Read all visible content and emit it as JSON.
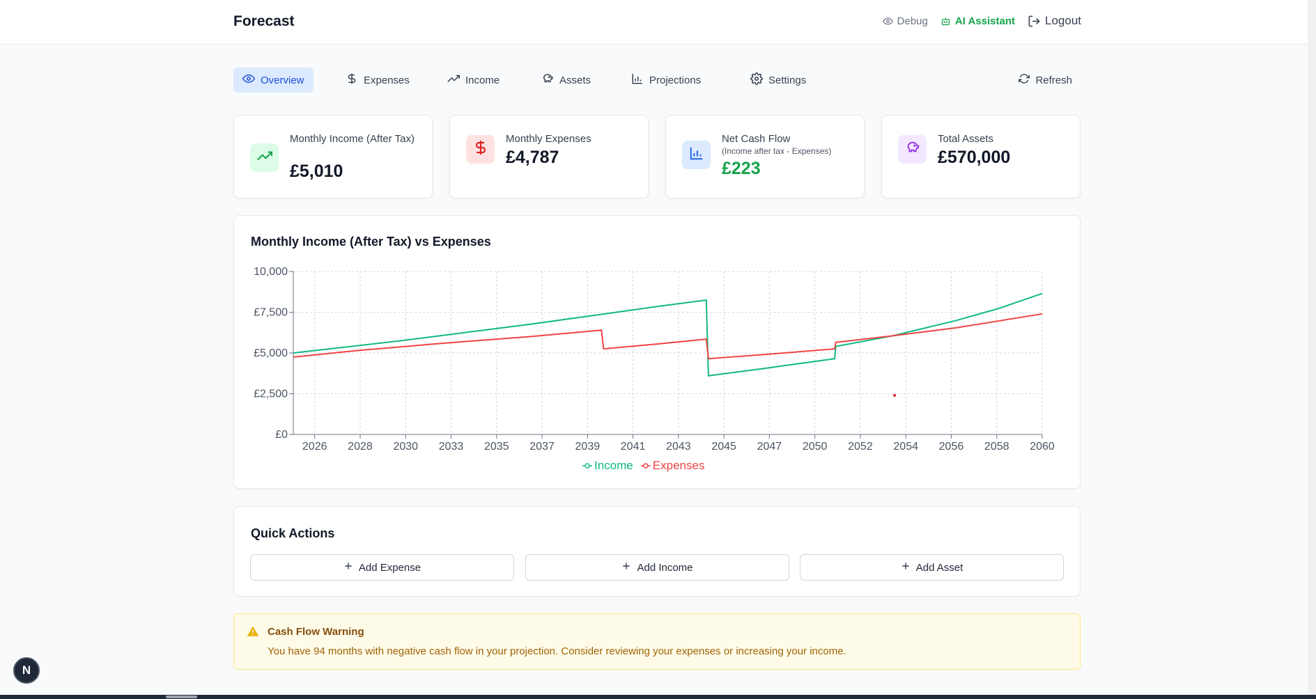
{
  "app": {
    "title": "Forecast"
  },
  "topnav": {
    "debug": "Debug",
    "ai_assistant": "AI Assistant",
    "logout": "Logout"
  },
  "tabs": [
    {
      "label": "Overview",
      "icon": "eye-icon",
      "active": true
    },
    {
      "label": "Expenses",
      "icon": "dollar-icon"
    },
    {
      "label": "Income",
      "icon": "trending-up-icon"
    },
    {
      "label": "Assets",
      "icon": "piggy-bank-icon"
    },
    {
      "label": "Projections",
      "icon": "bar-chart-icon"
    },
    {
      "label": "Settings",
      "icon": "gear-icon"
    }
  ],
  "refresh_label": "Refresh",
  "stats": [
    {
      "label": "Monthly Income (After Tax)",
      "value": "£5,010",
      "icon": "trending-up-icon",
      "color": "#16a34a"
    },
    {
      "label": "Monthly Expenses",
      "value": "£4,787",
      "icon": "dollar-icon",
      "color": "#dc2626"
    },
    {
      "label": "Net Cash Flow",
      "sublabel": "(Income after tax - Expenses)",
      "value": "£223",
      "icon": "bar-chart-icon",
      "color": "#2563eb"
    },
    {
      "label": "Total Assets",
      "value": "£570,000",
      "icon": "piggy-bank-icon",
      "color": "#9333ea"
    }
  ],
  "chart_data": {
    "type": "line",
    "title": "Monthly Income (After Tax) vs Expenses",
    "xlabel": "",
    "ylabel": "",
    "x_ticks": [
      "2026",
      "2028",
      "2030",
      "2033",
      "2035",
      "2037",
      "2039",
      "2041",
      "2043",
      "2045",
      "2047",
      "2050",
      "2052",
      "2054",
      "2056",
      "2058",
      "2060"
    ],
    "y_ticks": [
      "£0",
      "£2,500",
      "£5,000",
      "£7,500",
      "10,000"
    ],
    "ylim": [
      0,
      10000
    ],
    "xlim": [
      2025,
      2060
    ],
    "grid": true,
    "legend": "bottom-center",
    "series": [
      {
        "name": "Income",
        "color": "#10b981",
        "points": [
          [
            2025.0,
            5000
          ],
          [
            2027.0,
            5300
          ],
          [
            2030.0,
            5750
          ],
          [
            2033.0,
            6250
          ],
          [
            2036.0,
            6750
          ],
          [
            2039.0,
            7300
          ],
          [
            2042.0,
            7850
          ],
          [
            2044.3,
            8250
          ],
          [
            2044.4,
            3600
          ],
          [
            2047.0,
            4050
          ],
          [
            2050.3,
            4650
          ],
          [
            2050.35,
            5400
          ],
          [
            2053.0,
            6050
          ],
          [
            2056.0,
            7000
          ],
          [
            2058.0,
            7750
          ],
          [
            2060.0,
            8650
          ]
        ]
      },
      {
        "name": "Expenses",
        "color": "#ef4444",
        "points": [
          [
            2025.0,
            4750
          ],
          [
            2028.0,
            5150
          ],
          [
            2032.0,
            5600
          ],
          [
            2036.0,
            6000
          ],
          [
            2039.4,
            6400
          ],
          [
            2039.5,
            5250
          ],
          [
            2042.0,
            5550
          ],
          [
            2044.3,
            5850
          ],
          [
            2044.4,
            4650
          ],
          [
            2047.0,
            4900
          ],
          [
            2050.3,
            5250
          ],
          [
            2050.35,
            5650
          ],
          [
            2053.0,
            6050
          ],
          [
            2056.0,
            6550
          ],
          [
            2060.0,
            7400
          ]
        ]
      }
    ],
    "annotations": [
      {
        "x": 2053.1,
        "y": 2400,
        "color": "#dc2626",
        "type": "dot"
      }
    ]
  },
  "quick_actions": {
    "title": "Quick Actions",
    "buttons": [
      "Add Expense",
      "Add Income",
      "Add Asset"
    ]
  },
  "warning": {
    "title": "Cash Flow Warning",
    "text": "You have 94 months with negative cash flow in your projection. Consider reviewing your expenses or increasing your income."
  },
  "badge": "N"
}
